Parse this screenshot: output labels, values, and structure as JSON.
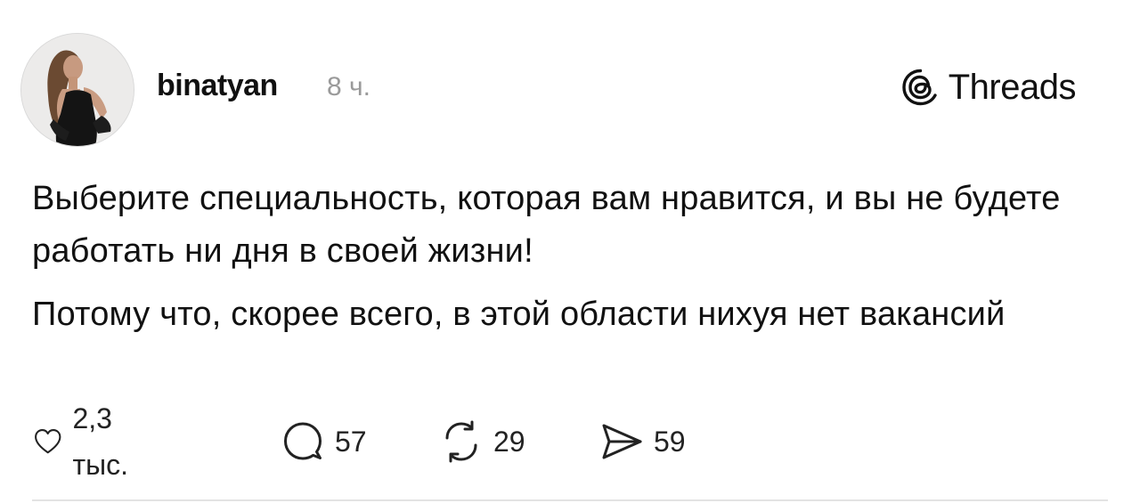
{
  "post": {
    "username": "binatyan",
    "time": "8 ч.",
    "brand": {
      "icon": "threads-logo-icon",
      "name": "Threads"
    },
    "paragraphs": [
      "Выберите специальность, которая вам нравится, и вы не будете работать ни дня в своей жизни!",
      "Потому что, скорее всего, в этой области нихуя нет вакансий"
    ],
    "actions": {
      "like": {
        "icon": "heart-icon",
        "count": "2,3 тыс."
      },
      "reply": {
        "icon": "comment-icon",
        "count": "57"
      },
      "repost": {
        "icon": "repost-icon",
        "count": "29"
      },
      "share": {
        "icon": "share-icon",
        "count": "59"
      }
    }
  }
}
